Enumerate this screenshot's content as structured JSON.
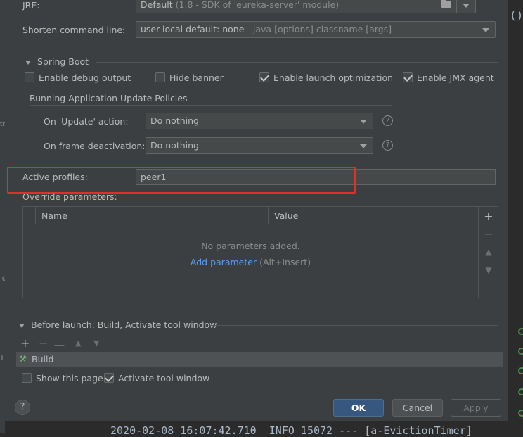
{
  "jre": {
    "label": "JRE:",
    "value": "Default",
    "detail": "(1.8 - SDK of 'eureka-server' module)"
  },
  "shorten": {
    "label": "Shorten command line:",
    "value": "user-local default: none",
    "detail": "- java [options] classname [args]"
  },
  "spring_boot": {
    "title": "Spring Boot",
    "checkboxes": [
      {
        "label": "Enable debug output",
        "checked": false
      },
      {
        "label": "Hide banner",
        "checked": false
      },
      {
        "label": "Enable launch optimization",
        "checked": true
      },
      {
        "label": "Enable JMX agent",
        "checked": true
      }
    ],
    "policies_title": "Running Application Update Policies",
    "on_update": {
      "label": "On 'Update' action:",
      "value": "Do nothing"
    },
    "on_frame": {
      "label": "On frame deactivation:",
      "value": "Do nothing"
    }
  },
  "active_profiles": {
    "label": "Active profiles:",
    "value": "peer1"
  },
  "override": {
    "label": "Override parameters:",
    "columns": [
      "Name",
      "Value"
    ],
    "empty_text": "No parameters added.",
    "add_link": "Add parameter",
    "add_hint": "(Alt+Insert)"
  },
  "before_launch": {
    "title": "Before launch: Build, Activate tool window",
    "items": [
      "Build"
    ],
    "show_this_page": {
      "label": "Show this page",
      "checked": false
    },
    "activate_tool_window": {
      "label": "Activate tool window",
      "checked": true
    }
  },
  "buttons": {
    "help": "?",
    "ok": "OK",
    "cancel": "Cancel",
    "apply": "Apply"
  },
  "background": {
    "paren": "()",
    "console_line": "2020-02-08 16:07:42.710  INFO 15072 --- [a-EvictionTimer]"
  },
  "colors": {
    "primary_button": "#365880",
    "highlight_box": "#e0302b",
    "link": "#589df6"
  }
}
